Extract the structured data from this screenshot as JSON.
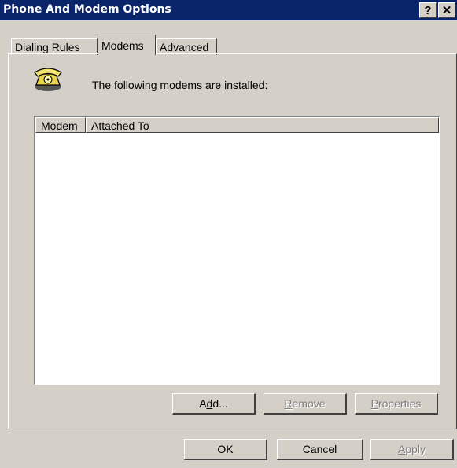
{
  "window": {
    "title": "Phone And Modem Options",
    "help_glyph": "?",
    "close_glyph": "✕"
  },
  "tabs": [
    {
      "label": "Dialing Rules",
      "active": false
    },
    {
      "label": "Modems",
      "active": true
    },
    {
      "label": "Advanced",
      "active": false
    }
  ],
  "modems_page": {
    "icon": "telephone-icon",
    "instruction_pre": "The following ",
    "instruction_key": "m",
    "instruction_post": "odems are  installed:",
    "columns": [
      "Modem",
      "Attached To"
    ],
    "rows": []
  },
  "panel_buttons": {
    "add": {
      "pre": "A",
      "key": "d",
      "post": "d...",
      "enabled": true
    },
    "remove": {
      "pre": "",
      "key": "R",
      "post": "emove",
      "enabled": false
    },
    "properties": {
      "pre": "",
      "key": "P",
      "post": "roperties",
      "enabled": false
    }
  },
  "dialog_buttons": {
    "ok": "OK",
    "cancel": "Cancel",
    "apply": {
      "pre": "",
      "key": "A",
      "post": "pply",
      "enabled": false
    }
  },
  "colors": {
    "titlebar": "#0a246a",
    "face": "#d4d0c8",
    "disabled_text": "#808080"
  }
}
